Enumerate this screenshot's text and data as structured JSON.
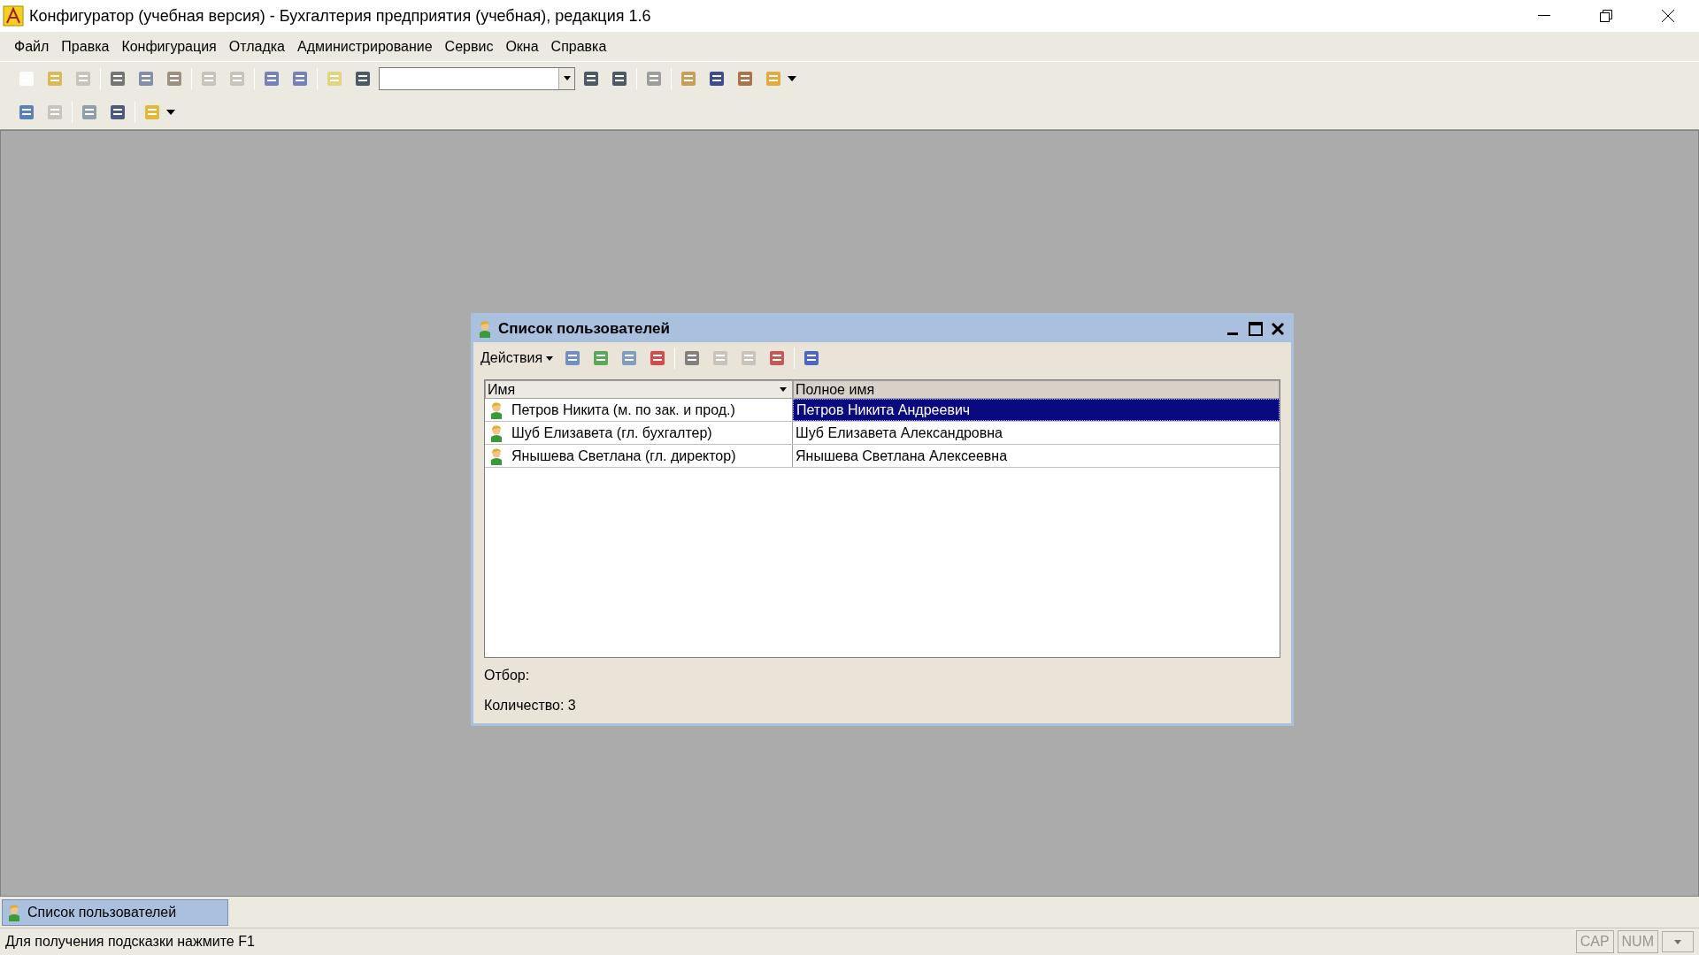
{
  "window": {
    "title": "Конфигуратор (учебная версия) - Бухгалтерия предприятия (учебная), редакция 1.6"
  },
  "menu": [
    "Файл",
    "Правка",
    "Конфигурация",
    "Отладка",
    "Администрирование",
    "Сервис",
    "Окна",
    "Справка"
  ],
  "dialog": {
    "title": "Список пользователей",
    "actions_label": "Действия",
    "table": {
      "columns": [
        {
          "label": "Имя",
          "sorted": true
        },
        {
          "label": "Полное имя",
          "sorted": false
        }
      ],
      "rows": [
        {
          "name": "Петров Никита (м. по зак. и прод.)",
          "full_name": "Петров Никита Андреевич",
          "selected": true
        },
        {
          "name": "Шуб Елизавета (гл. бухгалтер)",
          "full_name": "Шуб Елизавета Александровна",
          "selected": false
        },
        {
          "name": "Янышева Светлана (гл. директор)",
          "full_name": "Янышева Светлана Алексеевна",
          "selected": false
        }
      ]
    },
    "filter_label": "Отбор:",
    "count_label": "Количество: 3"
  },
  "taskbar": [
    {
      "label": "Список пользователей",
      "selected": true
    }
  ],
  "status_bar": {
    "hint": "Для получения подсказки нажмите F1",
    "indicators": [
      {
        "label": "CAP",
        "on": false
      },
      {
        "label": "NUM",
        "on": false
      }
    ]
  }
}
